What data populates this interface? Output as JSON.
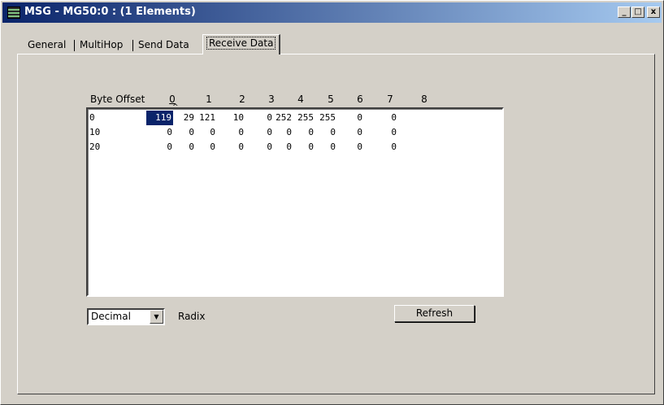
{
  "window": {
    "title": "MSG - MG50:0 : (1 Elements)",
    "buttons": {
      "minimize": "_",
      "maximize": "□",
      "close": "x"
    }
  },
  "tabs": [
    {
      "label": "General"
    },
    {
      "label": "MultiHop"
    },
    {
      "label": "Send Data"
    },
    {
      "label": "Receive Data"
    }
  ],
  "active_tab": "Receive Data",
  "grid": {
    "byte_offset_label": "Byte Offset",
    "columns": [
      "0",
      "1",
      "2",
      "3",
      "4",
      "5",
      "6",
      "7",
      "8"
    ],
    "rows": [
      {
        "offset": "0",
        "values": [
          "119",
          "29",
          "121",
          "10",
          "0",
          "252",
          "255",
          "255",
          "0",
          "0"
        ]
      },
      {
        "offset": "10",
        "values": [
          "0",
          "0",
          "0",
          "0",
          "0",
          "0",
          "0",
          "0",
          "0",
          "0"
        ]
      },
      {
        "offset": "20",
        "values": [
          "0",
          "0",
          "0",
          "0",
          "0",
          "0",
          "0",
          "0",
          "0",
          "0"
        ]
      }
    ],
    "selected_cell_value": "119"
  },
  "radix": {
    "selected": "Decimal",
    "label": "Radix"
  },
  "refresh_button": {
    "label": "Refresh"
  },
  "colors": {
    "titlebar_start": "#0a246a",
    "titlebar_end": "#a6caf0",
    "face": "#d4d0c8",
    "selection": "#0a246a"
  }
}
